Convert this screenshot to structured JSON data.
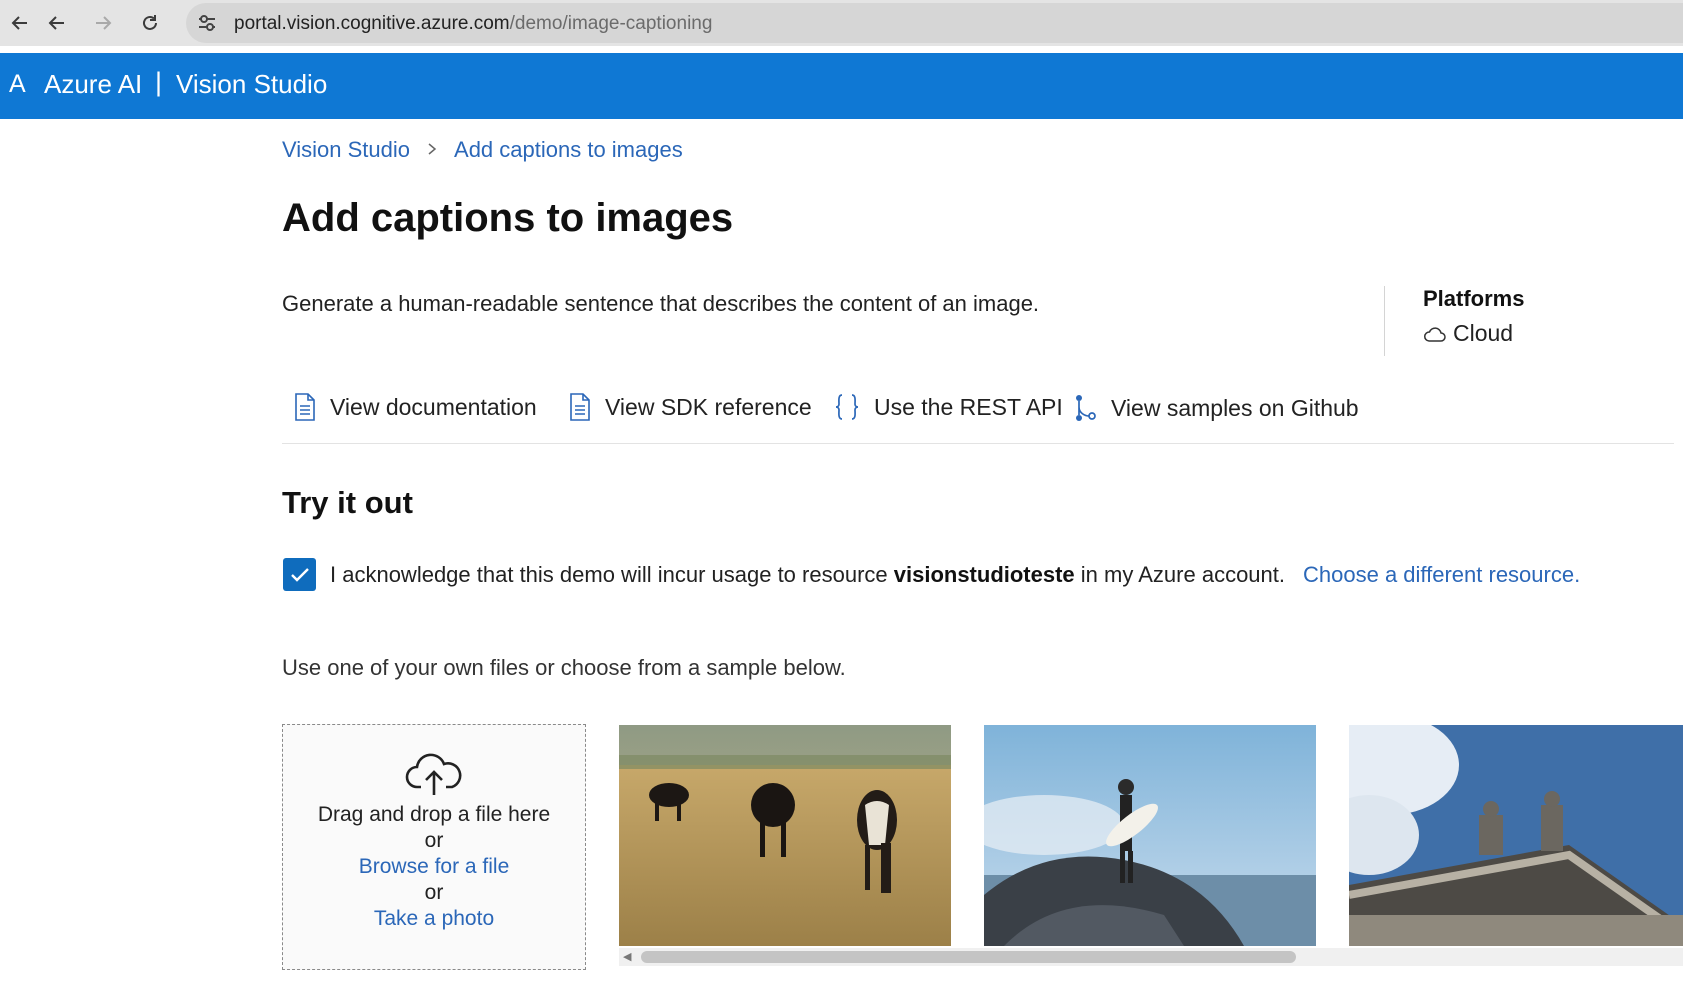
{
  "browser": {
    "url_host": "portal.vision.cognitive.azure.com",
    "url_path": "/demo/image-captioning"
  },
  "header": {
    "logo": "A",
    "brand": "Azure AI",
    "separator": "|",
    "product": "Vision Studio"
  },
  "breadcrumb": {
    "root": "Vision Studio",
    "current": "Add captions to images"
  },
  "page": {
    "title": "Add captions to images",
    "description": "Generate a human-readable sentence that describes the content of an image."
  },
  "platforms": {
    "title": "Platforms",
    "items": [
      "Cloud"
    ]
  },
  "links": {
    "documentation": "View documentation",
    "sdk": "View SDK reference",
    "rest": "Use the REST API",
    "github": "View samples on Github"
  },
  "try_it": {
    "title": "Try it out",
    "ack_prefix": "I acknowledge that this demo will incur usage to resource ",
    "resource": "visionstudioteste",
    "ack_suffix": " in my Azure account.",
    "choose_resource": "Choose a different resource.",
    "checked": true,
    "instructions": "Use one of your own files or choose from a sample below."
  },
  "dropzone": {
    "drag_text": "Drag and drop a file here",
    "or1": "or",
    "browse": "Browse for a file",
    "or2": "or",
    "take_photo": "Take a photo"
  },
  "colors": {
    "azure_blue": "#0f78d4",
    "link_blue": "#2b67b8",
    "checkbox_blue": "#0f6cbd"
  }
}
